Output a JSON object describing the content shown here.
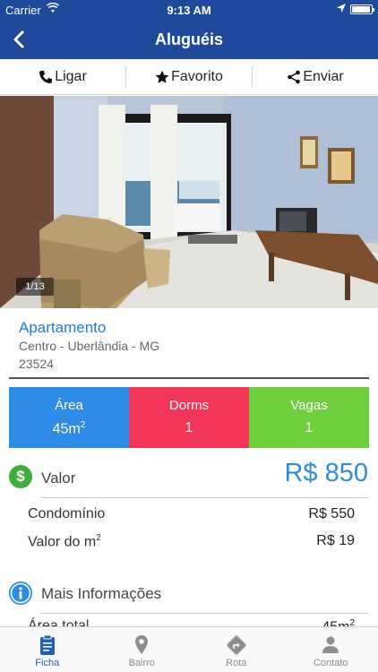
{
  "status_bar": {
    "carrier": "Carrier",
    "time": "9:13 AM"
  },
  "nav": {
    "title": "Aluguéis"
  },
  "actions": [
    {
      "label": "Ligar",
      "icon": "phone-icon"
    },
    {
      "label": "Favorito",
      "icon": "star-icon"
    },
    {
      "label": "Enviar",
      "icon": "share-icon"
    }
  ],
  "photo": {
    "counter": "1/13"
  },
  "property": {
    "type": "Apartamento",
    "location": "Centro - Uberlândia - MG",
    "code": "23524"
  },
  "stats": [
    {
      "label": "Área",
      "value": "45m",
      "unit_sup": "2",
      "color": "#2e8be6"
    },
    {
      "label": "Dorms",
      "value": "1",
      "unit_sup": "",
      "color": "#f2365a"
    },
    {
      "label": "Vagas",
      "value": "1",
      "unit_sup": "",
      "color": "#6fcf3c"
    }
  ],
  "valor": {
    "label": "Valor",
    "price": "R$ 850",
    "rows": [
      {
        "label": "Condomínio",
        "label_sup": "",
        "value": "R$ 550"
      },
      {
        "label": "Valor do m",
        "label_sup": "2",
        "value": "R$ 19"
      }
    ]
  },
  "mais_info": {
    "label": "Mais Informações",
    "partial_row": {
      "label": "Área total",
      "value": "45m",
      "value_sup": "2"
    }
  },
  "tabs": [
    {
      "label": "Ficha",
      "icon": "clipboard-icon",
      "active": true
    },
    {
      "label": "Bairro",
      "icon": "map-pin-icon",
      "active": false
    },
    {
      "label": "Rota",
      "icon": "route-icon",
      "active": false
    },
    {
      "label": "Contato",
      "icon": "person-icon",
      "active": false
    }
  ],
  "colors": {
    "nav": "#1f4a9b",
    "accent": "#2f8ce0",
    "dollar": "#3fad3f"
  }
}
